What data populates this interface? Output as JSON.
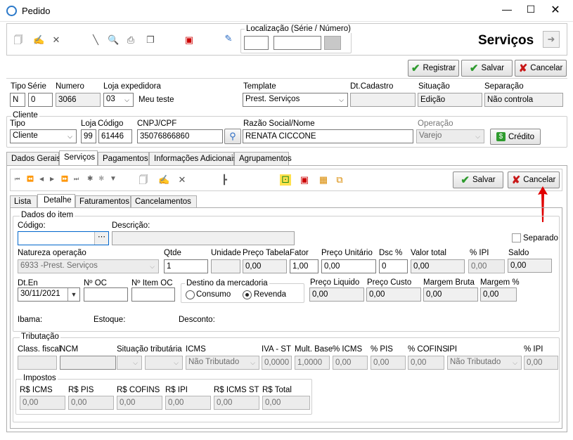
{
  "window": {
    "title": "Pedido"
  },
  "toolbar": {
    "localizacao_label": "Localização (Série / Número)",
    "heading": "Serviços"
  },
  "actions": {
    "registrar": "Registrar",
    "salvar": "Salvar",
    "cancelar": "Cancelar"
  },
  "header": {
    "tipo_label": "Tipo",
    "serie_label": "Série",
    "numero_label": "Numero",
    "loja_label": "Loja expedidora",
    "template_label": "Template",
    "dtcadastro_label": "Dt.Cadastro",
    "situacao_label": "Situação",
    "separacao_label": "Separação",
    "tipo": "N",
    "serie": "0",
    "numero": "3066",
    "loja": "03",
    "loja_nome": "Meu teste",
    "template": "Prest. Serviços",
    "dtcadastro": "",
    "situacao": "Edição",
    "separacao": "Não controla"
  },
  "cliente": {
    "group": "Cliente",
    "tipo_label": "Tipo",
    "loja_label": "Loja",
    "codigo_label": "Código",
    "cnpj_label": "CNPJ/CPF",
    "razao_label": "Razão Social/Nome",
    "operacao_label": "Operação",
    "tipo": "Cliente",
    "loja": "99",
    "codigo": "61446",
    "cnpj": "35076866860",
    "razao": "RENATA CICCONE",
    "operacao": "Varejo",
    "credito": "Crédito"
  },
  "tabs": [
    "Dados Gerais",
    "Serviços",
    "Pagamentos",
    "Informações Adicionais",
    "Agrupamentos"
  ],
  "subtabs": [
    "Lista",
    "Detalhe",
    "Faturamentos",
    "Cancelamentos"
  ],
  "item": {
    "group": "Dados do item",
    "codigo_label": "Código:",
    "descricao_label": "Descrição:",
    "separado_label": "Separado",
    "natureza_label": "Natureza operação",
    "natureza": "6933 -Prest. Serviços",
    "qtde_label": "Qtde",
    "unidade_label": "Unidade",
    "preco_tabela_label": "Preço Tabela",
    "fator_label": "Fator",
    "preco_unitario_label": "Preço Unitário",
    "dsc_label": "Dsc %",
    "valor_total_label": "Valor total",
    "ipi_label": "% IPI",
    "saldo_label": "Saldo",
    "qtde": "1",
    "preco_tabela": "0,00",
    "fator": "1,00",
    "preco_unitario": "0,00",
    "dsc": "0",
    "valor_total": "0,00",
    "ipi": "0,00",
    "saldo": "0,00",
    "dten_label": "Dt.En",
    "noc_label": "Nº OC",
    "nitem_label": "Nº Item OC",
    "dten": "30/11/2021",
    "destino_label": "Destino da mercadoria",
    "consumo": "Consumo",
    "revenda": "Revenda",
    "preco_liquido_label": "Preço Liquido",
    "preco_custo_label": "Preço Custo",
    "margem_bruta_label": "Margem Bruta",
    "margem_label": "Margem %",
    "preco_liquido": "0,00",
    "preco_custo": "0,00",
    "margem_bruta": "0,00",
    "margem": "0,00",
    "ibama_label": "Ibama:",
    "estoque_label": "Estoque:",
    "desconto_label": "Desconto:"
  },
  "tributacao": {
    "group": "Tributação",
    "class_label": "Class. fiscal",
    "ncm_label": "NCM",
    "situacao_label": "Situação tributária",
    "icms_label": "ICMS",
    "ivast_label": "IVA - ST",
    "multbase_label": "Mult. Base",
    "picms_label": "% ICMS",
    "pis_label": "% PIS",
    "cofins_label": "% COFINS",
    "ipi_label": "IPI",
    "pipi_label": "% IPI",
    "icms": "Não Tributado",
    "ivast": "0,0000",
    "multbase": "1,0000",
    "picms": "0,00",
    "pis": "0,00",
    "cofins": "0,00",
    "ipi": "Não Tributado",
    "pipi": "0,00"
  },
  "impostos": {
    "group": "Impostos",
    "icms_label": "R$ ICMS",
    "pis_label": "R$ PIS",
    "cofins_label": "R$ COFINS",
    "ipi_label": "R$ IPI",
    "icmsst_label": "R$ ICMS ST",
    "total_label": "R$ Total",
    "icms": "0,00",
    "pis": "0,00",
    "cofins": "0,00",
    "ipi": "0,00",
    "icmsst": "0,00",
    "total": "0,00"
  },
  "colors": {
    "accent": "#0066cc",
    "annotation": "#e00000",
    "save_green": "#2e9b2e",
    "cancel_red": "#c81818"
  }
}
